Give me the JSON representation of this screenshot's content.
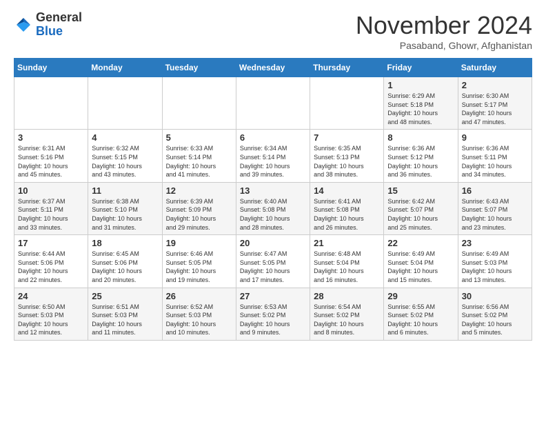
{
  "logo": {
    "general": "General",
    "blue": "Blue"
  },
  "header": {
    "month": "November 2024",
    "location": "Pasaband, Ghowr, Afghanistan"
  },
  "weekdays": [
    "Sunday",
    "Monday",
    "Tuesday",
    "Wednesday",
    "Thursday",
    "Friday",
    "Saturday"
  ],
  "weeks": [
    [
      {
        "day": "",
        "info": ""
      },
      {
        "day": "",
        "info": ""
      },
      {
        "day": "",
        "info": ""
      },
      {
        "day": "",
        "info": ""
      },
      {
        "day": "",
        "info": ""
      },
      {
        "day": "1",
        "info": "Sunrise: 6:29 AM\nSunset: 5:18 PM\nDaylight: 10 hours\nand 48 minutes."
      },
      {
        "day": "2",
        "info": "Sunrise: 6:30 AM\nSunset: 5:17 PM\nDaylight: 10 hours\nand 47 minutes."
      }
    ],
    [
      {
        "day": "3",
        "info": "Sunrise: 6:31 AM\nSunset: 5:16 PM\nDaylight: 10 hours\nand 45 minutes."
      },
      {
        "day": "4",
        "info": "Sunrise: 6:32 AM\nSunset: 5:15 PM\nDaylight: 10 hours\nand 43 minutes."
      },
      {
        "day": "5",
        "info": "Sunrise: 6:33 AM\nSunset: 5:14 PM\nDaylight: 10 hours\nand 41 minutes."
      },
      {
        "day": "6",
        "info": "Sunrise: 6:34 AM\nSunset: 5:14 PM\nDaylight: 10 hours\nand 39 minutes."
      },
      {
        "day": "7",
        "info": "Sunrise: 6:35 AM\nSunset: 5:13 PM\nDaylight: 10 hours\nand 38 minutes."
      },
      {
        "day": "8",
        "info": "Sunrise: 6:36 AM\nSunset: 5:12 PM\nDaylight: 10 hours\nand 36 minutes."
      },
      {
        "day": "9",
        "info": "Sunrise: 6:36 AM\nSunset: 5:11 PM\nDaylight: 10 hours\nand 34 minutes."
      }
    ],
    [
      {
        "day": "10",
        "info": "Sunrise: 6:37 AM\nSunset: 5:11 PM\nDaylight: 10 hours\nand 33 minutes."
      },
      {
        "day": "11",
        "info": "Sunrise: 6:38 AM\nSunset: 5:10 PM\nDaylight: 10 hours\nand 31 minutes."
      },
      {
        "day": "12",
        "info": "Sunrise: 6:39 AM\nSunset: 5:09 PM\nDaylight: 10 hours\nand 29 minutes."
      },
      {
        "day": "13",
        "info": "Sunrise: 6:40 AM\nSunset: 5:08 PM\nDaylight: 10 hours\nand 28 minutes."
      },
      {
        "day": "14",
        "info": "Sunrise: 6:41 AM\nSunset: 5:08 PM\nDaylight: 10 hours\nand 26 minutes."
      },
      {
        "day": "15",
        "info": "Sunrise: 6:42 AM\nSunset: 5:07 PM\nDaylight: 10 hours\nand 25 minutes."
      },
      {
        "day": "16",
        "info": "Sunrise: 6:43 AM\nSunset: 5:07 PM\nDaylight: 10 hours\nand 23 minutes."
      }
    ],
    [
      {
        "day": "17",
        "info": "Sunrise: 6:44 AM\nSunset: 5:06 PM\nDaylight: 10 hours\nand 22 minutes."
      },
      {
        "day": "18",
        "info": "Sunrise: 6:45 AM\nSunset: 5:06 PM\nDaylight: 10 hours\nand 20 minutes."
      },
      {
        "day": "19",
        "info": "Sunrise: 6:46 AM\nSunset: 5:05 PM\nDaylight: 10 hours\nand 19 minutes."
      },
      {
        "day": "20",
        "info": "Sunrise: 6:47 AM\nSunset: 5:05 PM\nDaylight: 10 hours\nand 17 minutes."
      },
      {
        "day": "21",
        "info": "Sunrise: 6:48 AM\nSunset: 5:04 PM\nDaylight: 10 hours\nand 16 minutes."
      },
      {
        "day": "22",
        "info": "Sunrise: 6:49 AM\nSunset: 5:04 PM\nDaylight: 10 hours\nand 15 minutes."
      },
      {
        "day": "23",
        "info": "Sunrise: 6:49 AM\nSunset: 5:03 PM\nDaylight: 10 hours\nand 13 minutes."
      }
    ],
    [
      {
        "day": "24",
        "info": "Sunrise: 6:50 AM\nSunset: 5:03 PM\nDaylight: 10 hours\nand 12 minutes."
      },
      {
        "day": "25",
        "info": "Sunrise: 6:51 AM\nSunset: 5:03 PM\nDaylight: 10 hours\nand 11 minutes."
      },
      {
        "day": "26",
        "info": "Sunrise: 6:52 AM\nSunset: 5:03 PM\nDaylight: 10 hours\nand 10 minutes."
      },
      {
        "day": "27",
        "info": "Sunrise: 6:53 AM\nSunset: 5:02 PM\nDaylight: 10 hours\nand 9 minutes."
      },
      {
        "day": "28",
        "info": "Sunrise: 6:54 AM\nSunset: 5:02 PM\nDaylight: 10 hours\nand 8 minutes."
      },
      {
        "day": "29",
        "info": "Sunrise: 6:55 AM\nSunset: 5:02 PM\nDaylight: 10 hours\nand 6 minutes."
      },
      {
        "day": "30",
        "info": "Sunrise: 6:56 AM\nSunset: 5:02 PM\nDaylight: 10 hours\nand 5 minutes."
      }
    ]
  ]
}
